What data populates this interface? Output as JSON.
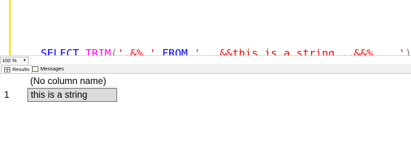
{
  "editor": {
    "code_tokens": [
      {
        "text": "SELECT ",
        "kind": "kw"
      },
      {
        "text": "TRIM",
        "kind": "fn"
      },
      {
        "text": "(",
        "kind": "punc"
      },
      {
        "text": "'.&% '",
        "kind": "str"
      },
      {
        "text": " FROM ",
        "kind": "kw"
      },
      {
        "text": "'   &&this is a string...&&%    '",
        "kind": "str"
      },
      {
        "text": ");",
        "kind": "punc"
      }
    ]
  },
  "zoom": {
    "value": "100 %"
  },
  "tabs": {
    "results_label": "Results",
    "messages_label": "Messages"
  },
  "grid": {
    "column_header": "(No column name)",
    "rows": [
      {
        "row_number": "1",
        "value": "this is a string"
      }
    ]
  },
  "colors": {
    "keyword": "#0000ff",
    "function": "#ff00ff",
    "string": "#ff0000",
    "punctuation": "#808080",
    "margin_bar": "#f5e63c"
  }
}
